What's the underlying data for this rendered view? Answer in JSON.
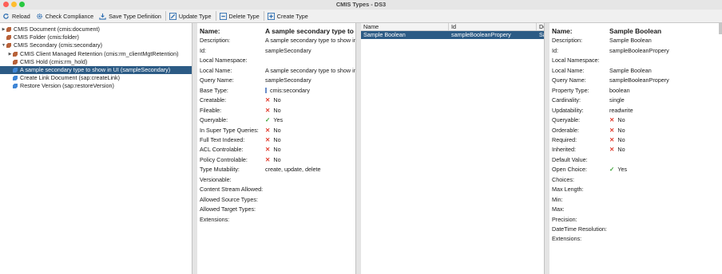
{
  "window": {
    "title": "CMIS Types - DS3"
  },
  "toolbar": [
    {
      "name": "reload-button",
      "label": "Reload",
      "icon": "reload-icon"
    },
    {
      "name": "check-compliance-button",
      "label": "Check Compliance",
      "icon": "gear-icon"
    },
    {
      "name": "save-type-definition-button",
      "label": "Save Type Definition",
      "icon": "download-icon"
    },
    {
      "name": "update-type-button",
      "label": "Update Type",
      "icon": "edit-icon"
    },
    {
      "name": "delete-type-button",
      "label": "Delete Type",
      "icon": "minus-box-icon"
    },
    {
      "name": "create-type-button",
      "label": "Create Type",
      "icon": "plus-box-icon"
    }
  ],
  "tree": [
    {
      "label": "CMIS Document (cmis:document)",
      "level": 0,
      "expander": "▶",
      "icon": "type-icon"
    },
    {
      "label": "CMIS Folder (cmis:folder)",
      "level": 0,
      "expander": "",
      "icon": "type-icon"
    },
    {
      "label": "CMIS Secondary (cmis:secondary)",
      "level": 0,
      "expander": "▼",
      "icon": "type-icon"
    },
    {
      "label": "CMIS Client Managed Retention (cmis:rm_clientMgtRetention)",
      "level": 1,
      "expander": "▶",
      "icon": "type-icon"
    },
    {
      "label": "CMIS Hold (cmis:rm_hold)",
      "level": 1,
      "expander": "",
      "icon": "type-icon"
    },
    {
      "label": "A sample secondary type to show in UI (sampleSecondary)",
      "level": 1,
      "expander": "",
      "icon": "secondary-type-icon",
      "selected": true
    },
    {
      "label": "Create Link Document (sap:createLink)",
      "level": 1,
      "expander": "",
      "icon": "secondary-type-icon"
    },
    {
      "label": "Restore Version (sap:restoreVersion)",
      "level": 1,
      "expander": "",
      "icon": "secondary-type-icon"
    }
  ],
  "type_props": {
    "rows": [
      {
        "label": "Name:",
        "value": "A sample secondary type to show in UI",
        "header": true
      },
      {
        "label": "Description:",
        "value": "A sample secondary type to show in UI"
      },
      {
        "label": "Id:",
        "value": "sampleSecondary"
      },
      {
        "label": "Local Namespace:",
        "value": ""
      },
      {
        "label": "Local Name:",
        "value": "A sample secondary type to show in UI"
      },
      {
        "label": "Query Name:",
        "value": "sampleSecondary"
      },
      {
        "label": "Base Type:",
        "value": "cmis:secondary",
        "mark": "base"
      },
      {
        "label": "Creatable:",
        "value": "No",
        "mark": "x"
      },
      {
        "label": "Fileable:",
        "value": "No",
        "mark": "x"
      },
      {
        "label": "Queryable:",
        "value": "Yes",
        "mark": "check"
      },
      {
        "label": "In Super Type Queries:",
        "value": "No",
        "mark": "x"
      },
      {
        "label": "Full Text Indexed:",
        "value": "No",
        "mark": "x"
      },
      {
        "label": "ACL Controlable:",
        "value": "No",
        "mark": "x"
      },
      {
        "label": "Policy Controlable:",
        "value": "No",
        "mark": "x"
      },
      {
        "label": "Type Mutability:",
        "value": "create, update, delete"
      },
      {
        "label": "Versionable:",
        "value": ""
      },
      {
        "label": "Content Stream Allowed:",
        "value": ""
      },
      {
        "label": "Allowed Source Types:",
        "value": ""
      },
      {
        "label": "Allowed Target Types:",
        "value": ""
      },
      {
        "label": "Extensions:",
        "value": ""
      }
    ]
  },
  "prop_table": {
    "columns": [
      "Name",
      "Id",
      "De"
    ],
    "rows": [
      {
        "name": "Sample Boolean",
        "id": "sampleBooleanPropery",
        "desc": "Sa"
      }
    ]
  },
  "prop_details": {
    "rows": [
      {
        "label": "Name:",
        "value": "Sample Boolean",
        "header": true
      },
      {
        "label": "Description:",
        "value": "Sample Boolean"
      },
      {
        "label": "Id:",
        "value": "sampleBooleanPropery"
      },
      {
        "label": "Local Namespace:",
        "value": ""
      },
      {
        "label": "Local Name:",
        "value": "Sample Boolean"
      },
      {
        "label": "Query Name:",
        "value": "sampleBooleanPropery"
      },
      {
        "label": "Property Type:",
        "value": "boolean"
      },
      {
        "label": "Cardinality:",
        "value": "single"
      },
      {
        "label": "Updatability:",
        "value": "readwrite"
      },
      {
        "label": "Queryable:",
        "value": "No",
        "mark": "x"
      },
      {
        "label": "Orderable:",
        "value": "No",
        "mark": "x"
      },
      {
        "label": "Required:",
        "value": "No",
        "mark": "x"
      },
      {
        "label": "Inherited:",
        "value": "No",
        "mark": "x"
      },
      {
        "label": "Default Value:",
        "value": ""
      },
      {
        "label": "Open Choice:",
        "value": "Yes",
        "mark": "check"
      },
      {
        "label": "Choices:",
        "value": ""
      },
      {
        "label": "Max Length:",
        "value": ""
      },
      {
        "label": "Min:",
        "value": ""
      },
      {
        "label": "Max:",
        "value": ""
      },
      {
        "label": "Precision:",
        "value": ""
      },
      {
        "label": "DateTime Resolution:",
        "value": ""
      },
      {
        "label": "Extensions:",
        "value": ""
      }
    ]
  },
  "colors": {
    "selection": "#2c5b85",
    "no": "#e03a2c",
    "yes": "#3aa236"
  }
}
